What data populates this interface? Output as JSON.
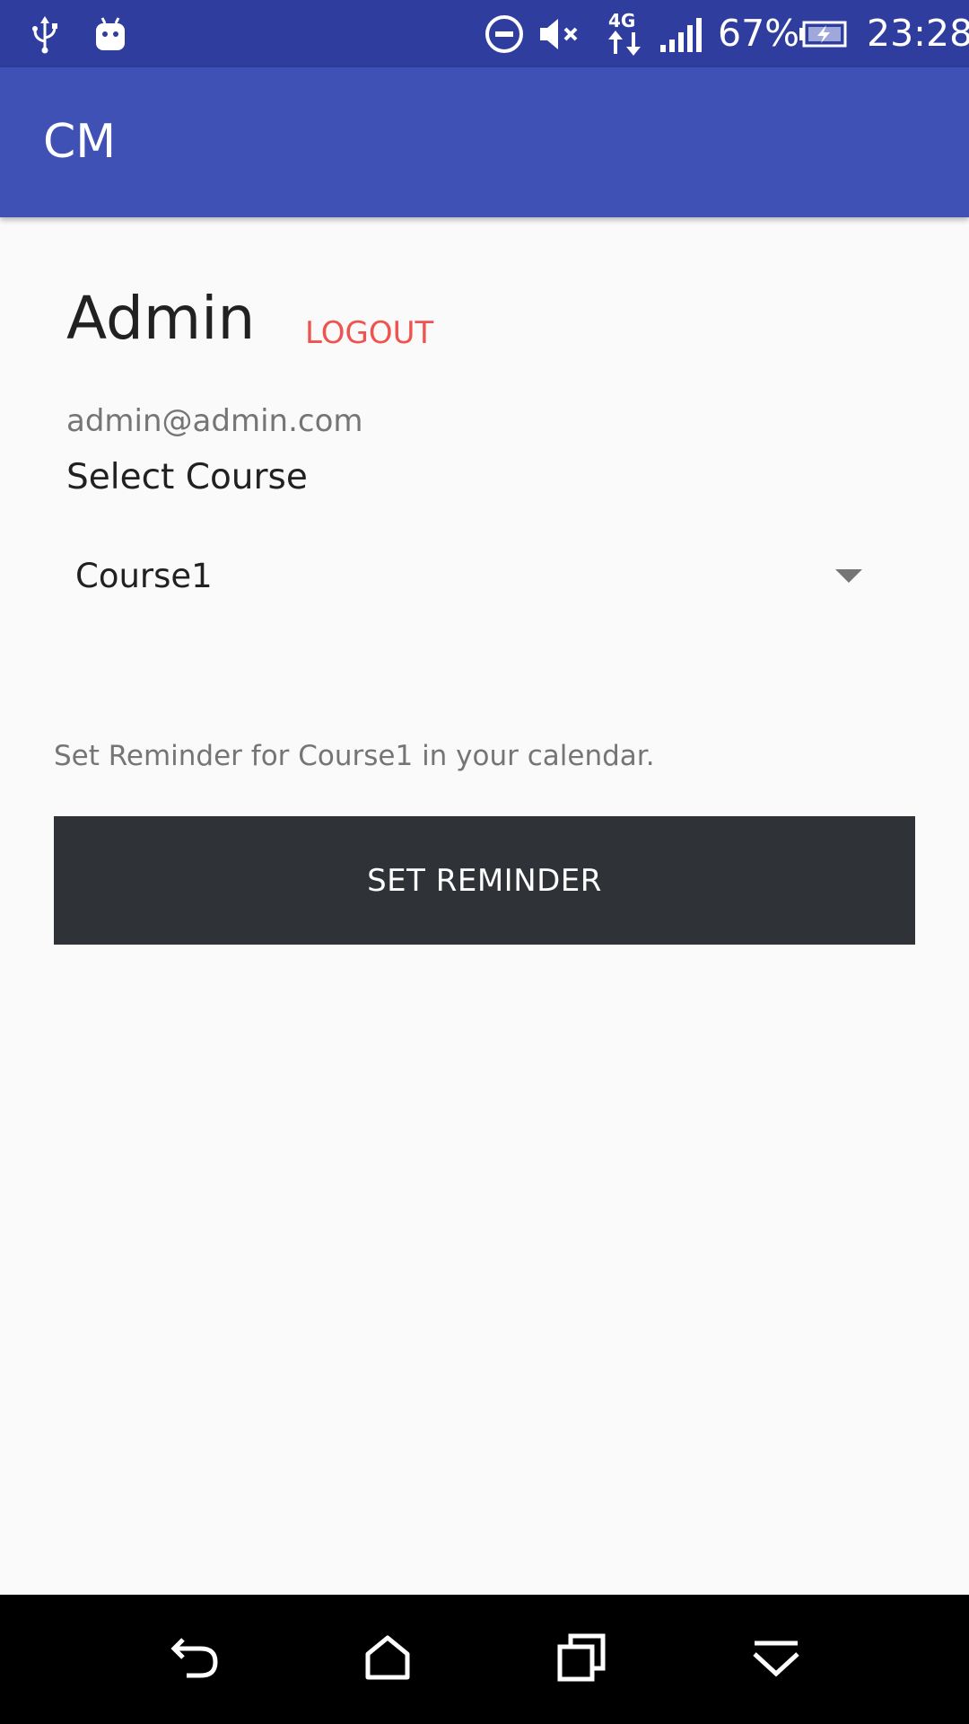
{
  "status_bar": {
    "battery": "67%",
    "time": "23:28",
    "network": "4G",
    "icons": [
      "usb-icon",
      "android-debug-icon",
      "do-not-disturb-icon",
      "volume-muted-icon",
      "network-4g-icon",
      "signal-icon",
      "battery-charging-icon"
    ]
  },
  "app_bar": {
    "title": "CM"
  },
  "profile": {
    "name": "Admin",
    "logout_label": "LOGOUT",
    "email": "admin@admin.com"
  },
  "course": {
    "select_label": "Select Course",
    "selected": "Course1"
  },
  "reminder": {
    "hint": "Set Reminder for Course1 in your calendar.",
    "button_label": "SET REMINDER"
  },
  "nav_bar": {
    "icons": [
      "back-icon",
      "home-icon",
      "recents-icon",
      "notification-dropdown-icon"
    ]
  },
  "colors": {
    "status_bar": "#2f3e9e",
    "app_bar": "#3f51b5",
    "logout": "#ef5350",
    "button": "#2f3237",
    "background": "#fafafa"
  }
}
